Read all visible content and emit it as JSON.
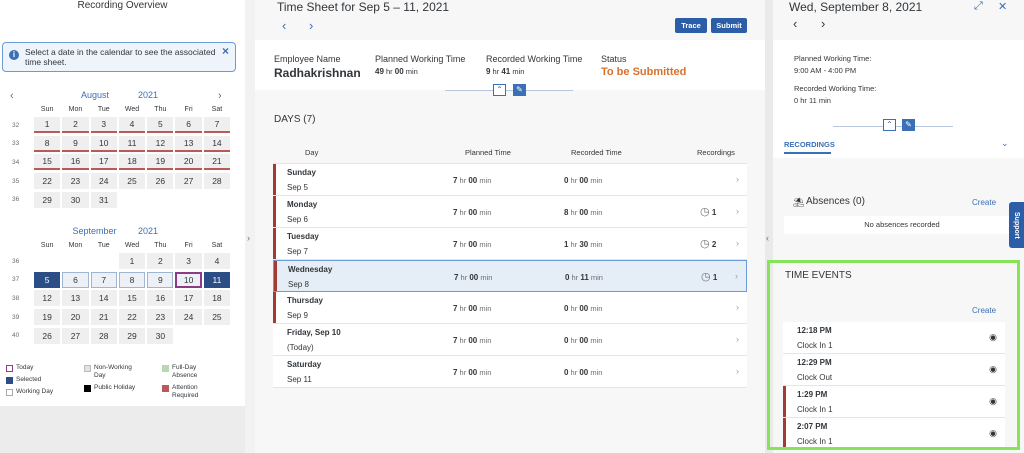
{
  "left": {
    "title": "Recording Overview",
    "info": "Select a date in the calendar to see the associated time sheet.",
    "august": {
      "month": "August",
      "year": "2021"
    },
    "september": {
      "month": "September",
      "year": "2021"
    },
    "weekdays": [
      "Sun",
      "Mon",
      "Tue",
      "Wed",
      "Thu",
      "Fri",
      "Sat"
    ],
    "aug_weeks": [
      {
        "wn": "32",
        "days": [
          "1",
          "2",
          "3",
          "4",
          "5",
          "6",
          "7"
        ]
      },
      {
        "wn": "33",
        "days": [
          "8",
          "9",
          "10",
          "11",
          "12",
          "13",
          "14"
        ]
      },
      {
        "wn": "34",
        "days": [
          "15",
          "16",
          "17",
          "18",
          "19",
          "20",
          "21"
        ]
      },
      {
        "wn": "35",
        "days": [
          "22",
          "23",
          "24",
          "25",
          "26",
          "27",
          "28"
        ]
      },
      {
        "wn": "36",
        "days": [
          "29",
          "30",
          "31",
          "",
          "",
          "",
          ""
        ]
      }
    ],
    "sep_weeks": [
      {
        "wn": "36",
        "days": [
          "",
          "",
          "",
          "1",
          "2",
          "3",
          "4"
        ]
      },
      {
        "wn": "37",
        "days": [
          "5",
          "6",
          "7",
          "8",
          "9",
          "10",
          "11"
        ]
      },
      {
        "wn": "38",
        "days": [
          "12",
          "13",
          "14",
          "15",
          "16",
          "17",
          "18"
        ]
      },
      {
        "wn": "39",
        "days": [
          "19",
          "20",
          "21",
          "22",
          "23",
          "24",
          "25"
        ]
      },
      {
        "wn": "40",
        "days": [
          "26",
          "27",
          "28",
          "29",
          "30",
          "",
          ""
        ]
      }
    ],
    "legend": {
      "today": "Today",
      "selected": "Selected",
      "working": "Working Day",
      "nonworking": "Non-Working Day",
      "holiday": "Public Holiday",
      "fullday": "Full-Day Absence",
      "attention": "Attention Required"
    }
  },
  "mid": {
    "title": "Time Sheet for Sep 5 – 11, 2021",
    "trace": "Trace",
    "submit": "Submit",
    "emp_label": "Employee Name",
    "emp_name": "Radhakrishnan",
    "planned_label": "Planned Working Time",
    "planned_hr": "49",
    "planned_min": "00",
    "recorded_label": "Recorded Working Time",
    "recorded_hr": "9",
    "recorded_min": "41",
    "status_label": "Status",
    "status": "To be Submitted",
    "days_title": "DAYS (7)",
    "cols": {
      "day": "Day",
      "planned": "Planned Time",
      "recorded": "Recorded Time",
      "recordings": "Recordings"
    },
    "hr": "hr",
    "min": "min",
    "rows": [
      {
        "d1": "Sunday",
        "d2": "Sep 5",
        "ph": "7",
        "pm": "00",
        "rh": "0",
        "rm": "00",
        "rec": ""
      },
      {
        "d1": "Monday",
        "d2": "Sep 6",
        "ph": "7",
        "pm": "00",
        "rh": "8",
        "rm": "00",
        "rec": "1"
      },
      {
        "d1": "Tuesday",
        "d2": "Sep 7",
        "ph": "7",
        "pm": "00",
        "rh": "1",
        "rm": "30",
        "rec": "2"
      },
      {
        "d1": "Wednesday",
        "d2": "Sep 8",
        "ph": "7",
        "pm": "00",
        "rh": "0",
        "rm": "11",
        "rec": "1"
      },
      {
        "d1": "Thursday",
        "d2": "Sep 9",
        "ph": "7",
        "pm": "00",
        "rh": "0",
        "rm": "00",
        "rec": ""
      },
      {
        "d1": "Friday, Sep 10",
        "d2": "(Today)",
        "ph": "7",
        "pm": "00",
        "rh": "0",
        "rm": "00",
        "rec": ""
      },
      {
        "d1": "Saturday",
        "d2": "Sep 11",
        "ph": "7",
        "pm": "00",
        "rh": "0",
        "rm": "00",
        "rec": ""
      }
    ]
  },
  "right": {
    "title": "Wed, September 8, 2021",
    "planned_label": "Planned Working Time:",
    "planned_value": "9:00 AM - 4:00 PM",
    "recorded_label": "Recorded Working Time:",
    "recorded_value": "0 hr 11 min",
    "tab": "RECORDINGS",
    "absences_title": "Absences (0)",
    "absences_create": "Create",
    "absences_empty": "No absences recorded",
    "te_title": "TIME EVENTS",
    "te_create": "Create",
    "support": "Support",
    "events": [
      {
        "time": "12:18 PM",
        "action": "Clock In 1"
      },
      {
        "time": "12:29 PM",
        "action": "Clock Out"
      },
      {
        "time": "1:29 PM",
        "action": "Clock In 1"
      },
      {
        "time": "2:07 PM",
        "action": "Clock In 1"
      }
    ]
  }
}
